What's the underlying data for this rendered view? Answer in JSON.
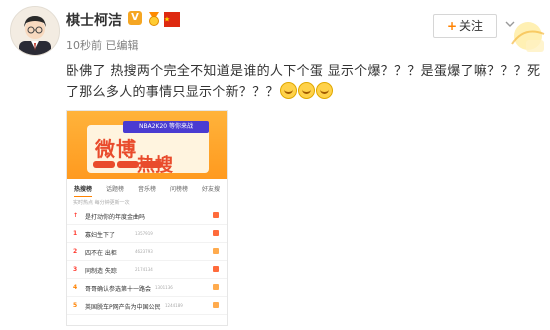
{
  "post": {
    "author": "棋士柯洁",
    "verified_badge": "V",
    "meta": "10秒前  已编辑",
    "follow_label": "关注",
    "text": "卧佛了 热搜两个完全不知道是谁的人下个蛋 显示个爆？？？是蛋爆了嘛？？？死了那么多人的事情只显示个新？？？",
    "emoji_count": 3
  },
  "screenshot": {
    "hero_banner": "NBA2K20 等你来战",
    "hero_title_line1": "微博",
    "hero_title_line2": "热搜",
    "tabs": [
      "热搜榜",
      "话题榜",
      "音乐榜",
      "问榜榜",
      "好友搜"
    ],
    "note": "实时热点 每分钟更新一次",
    "rows": [
      {
        "rank": "↑",
        "text": "是打动你的年度金曲吗",
        "count": "",
        "tag": "hot"
      },
      {
        "rank": "1",
        "text": "寡妇生下了",
        "count": "1357919",
        "tag": "hot"
      },
      {
        "rank": "2",
        "text": "四不在 出柜",
        "count": "4623793",
        "tag": "normal"
      },
      {
        "rank": "3",
        "text": "同制造 失踪",
        "count": "2174134",
        "tag": "hot"
      },
      {
        "rank": "4",
        "text": "哥哥确认参选第十一路会",
        "count": "1301136",
        "tag": "normal"
      },
      {
        "rank": "5",
        "text": "英国脱车P网产告为中国公民",
        "count": "1244189",
        "tag": "normal"
      }
    ]
  },
  "colors": {
    "accent": "#ff8200",
    "hot": "#ff3b30"
  }
}
